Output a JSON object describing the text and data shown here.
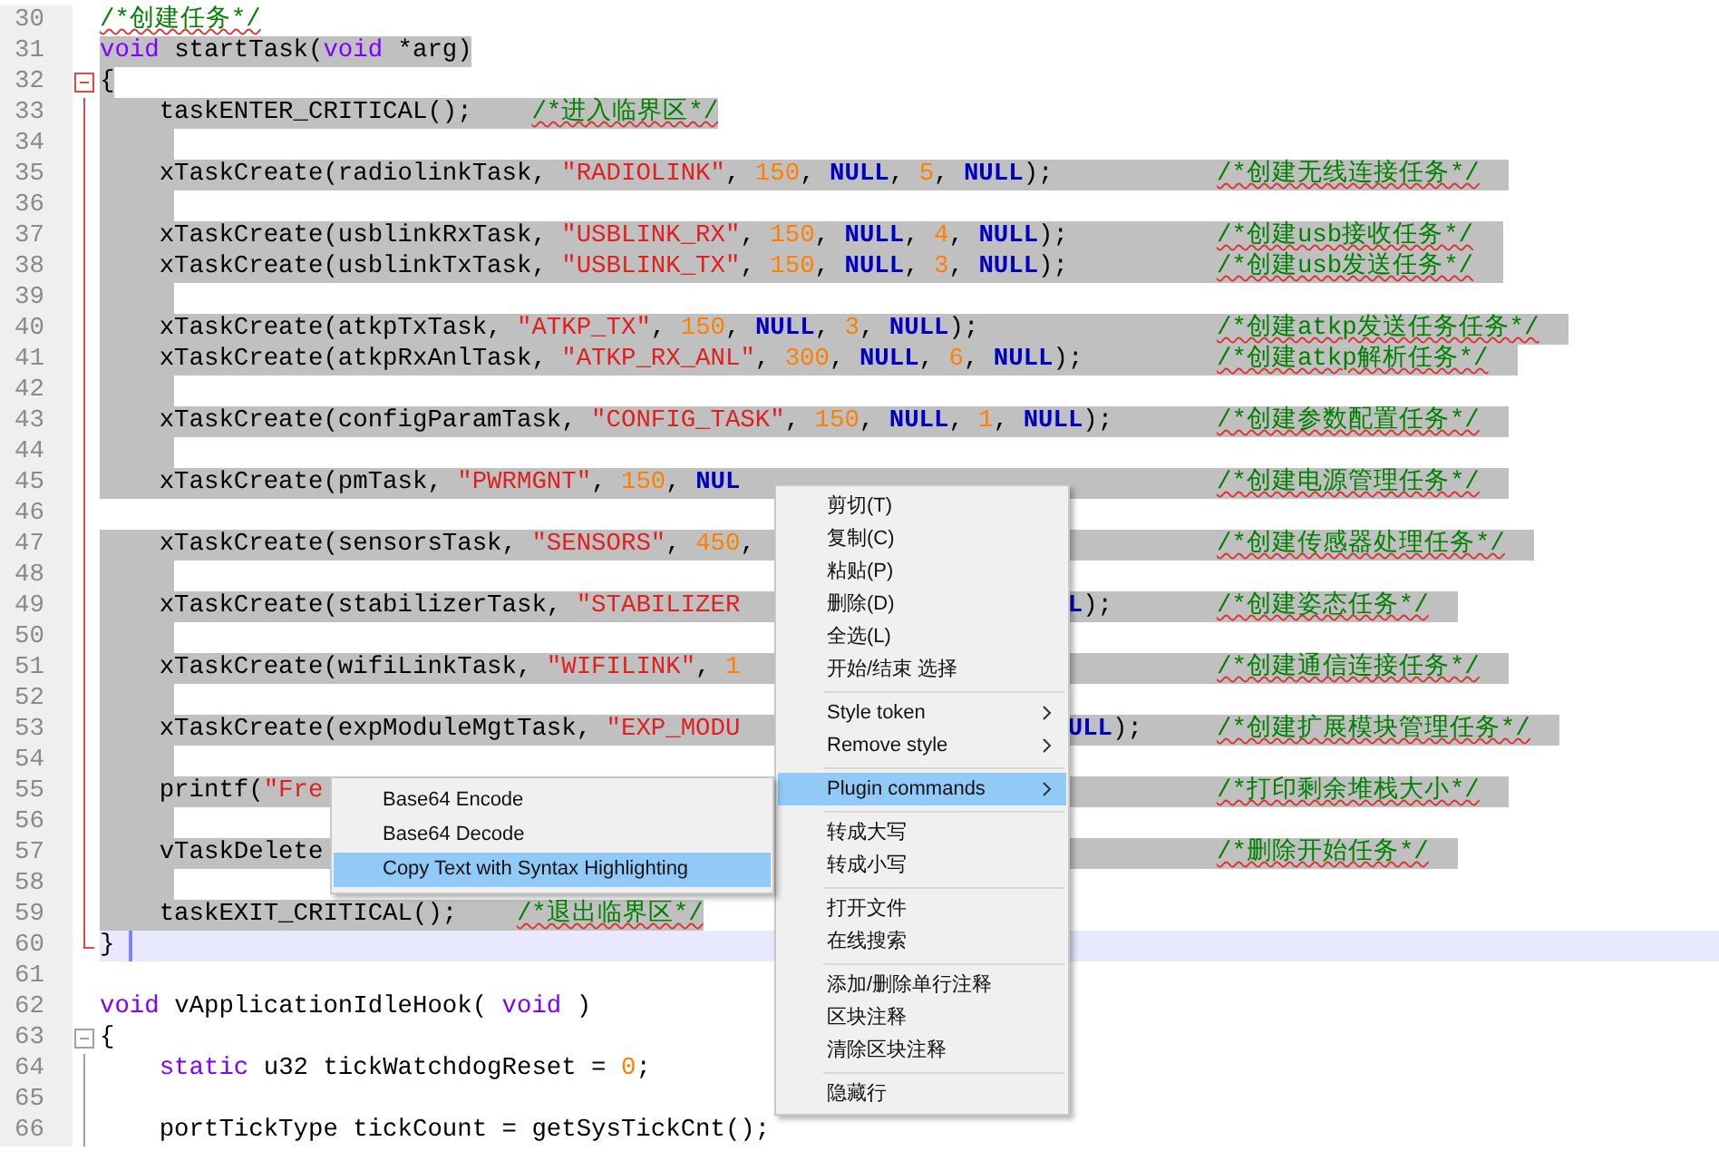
{
  "editor": {
    "lines": [
      {
        "number": "30",
        "selected": false,
        "current": false,
        "indented": false,
        "tokens": [
          {
            "kind": "comment",
            "text": "/*创建任务*/"
          }
        ]
      },
      {
        "number": "31",
        "selected": true,
        "current": false,
        "indented": false,
        "tokens": [
          {
            "kind": "kw",
            "text": "void"
          },
          {
            "kind": "plain",
            "text": " startTask("
          },
          {
            "kind": "kw",
            "text": "void"
          },
          {
            "kind": "plain",
            "text": " *arg)"
          }
        ]
      },
      {
        "number": "32",
        "selected": true,
        "current": false,
        "indented": false,
        "fold": {
          "kind": "start",
          "active": true
        },
        "tokens": [
          {
            "kind": "plain",
            "text": "{"
          }
        ]
      },
      {
        "number": "33",
        "selected": true,
        "current": false,
        "indented": true,
        "fold": {
          "kind": "line",
          "active": true
        },
        "tokens": [
          {
            "kind": "plain",
            "text": "taskENTER_CRITICAL();"
          },
          {
            "kind": "comment",
            "text": "/*进入临界区*/"
          }
        ]
      },
      {
        "number": "34",
        "selected": true,
        "current": false,
        "indented": true,
        "fold": {
          "kind": "line",
          "active": true
        }
      },
      {
        "number": "35",
        "selected": true,
        "current": false,
        "indented": true,
        "fold": {
          "kind": "line",
          "active": true
        },
        "tokens": [
          {
            "kind": "plain",
            "text": "xTaskCreate(radiolinkTask, "
          },
          {
            "kind": "str",
            "text": "\"RADIOLINK\""
          },
          {
            "kind": "plain",
            "text": ", "
          },
          {
            "kind": "num",
            "text": "150"
          },
          {
            "kind": "plain",
            "text": ", "
          },
          {
            "kind": "null",
            "text": "NULL"
          },
          {
            "kind": "plain",
            "text": ", "
          },
          {
            "kind": "num",
            "text": "5"
          },
          {
            "kind": "plain",
            "text": ", "
          },
          {
            "kind": "null",
            "text": "NULL"
          },
          {
            "kind": "plain",
            "text": ");"
          }
        ],
        "comment": "/*创建无线连接任务*/"
      },
      {
        "number": "36",
        "selected": true,
        "current": false,
        "indented": true,
        "fold": {
          "kind": "line",
          "active": true
        }
      },
      {
        "number": "37",
        "selected": true,
        "current": false,
        "indented": true,
        "fold": {
          "kind": "line",
          "active": true
        },
        "tokens": [
          {
            "kind": "plain",
            "text": "xTaskCreate(usblinkRxTask, "
          },
          {
            "kind": "str",
            "text": "\"USBLINK_RX\""
          },
          {
            "kind": "plain",
            "text": ", "
          },
          {
            "kind": "num",
            "text": "150"
          },
          {
            "kind": "plain",
            "text": ", "
          },
          {
            "kind": "null",
            "text": "NULL"
          },
          {
            "kind": "plain",
            "text": ", "
          },
          {
            "kind": "num",
            "text": "4"
          },
          {
            "kind": "plain",
            "text": ", "
          },
          {
            "kind": "null",
            "text": "NULL"
          },
          {
            "kind": "plain",
            "text": ");"
          }
        ],
        "comment": "/*创建usb接收任务*/"
      },
      {
        "number": "38",
        "selected": true,
        "current": false,
        "indented": true,
        "fold": {
          "kind": "line",
          "active": true
        },
        "tokens": [
          {
            "kind": "plain",
            "text": "xTaskCreate(usblinkTxTask, "
          },
          {
            "kind": "str",
            "text": "\"USBLINK_TX\""
          },
          {
            "kind": "plain",
            "text": ", "
          },
          {
            "kind": "num",
            "text": "150"
          },
          {
            "kind": "plain",
            "text": ", "
          },
          {
            "kind": "null",
            "text": "NULL"
          },
          {
            "kind": "plain",
            "text": ", "
          },
          {
            "kind": "num",
            "text": "3"
          },
          {
            "kind": "plain",
            "text": ", "
          },
          {
            "kind": "null",
            "text": "NULL"
          },
          {
            "kind": "plain",
            "text": ");"
          }
        ],
        "comment": "/*创建usb发送任务*/"
      },
      {
        "number": "39",
        "selected": true,
        "current": false,
        "indented": true,
        "fold": {
          "kind": "line",
          "active": true
        }
      },
      {
        "number": "40",
        "selected": true,
        "current": false,
        "indented": true,
        "fold": {
          "kind": "line",
          "active": true
        },
        "tokens": [
          {
            "kind": "plain",
            "text": "xTaskCreate(atkpTxTask, "
          },
          {
            "kind": "str",
            "text": "\"ATKP_TX\""
          },
          {
            "kind": "plain",
            "text": ", "
          },
          {
            "kind": "num",
            "text": "150"
          },
          {
            "kind": "plain",
            "text": ", "
          },
          {
            "kind": "null",
            "text": "NULL"
          },
          {
            "kind": "plain",
            "text": ", "
          },
          {
            "kind": "num",
            "text": "3"
          },
          {
            "kind": "plain",
            "text": ", "
          },
          {
            "kind": "null",
            "text": "NULL"
          },
          {
            "kind": "plain",
            "text": ");"
          }
        ],
        "comment": "/*创建atkp发送任务任务*/"
      },
      {
        "number": "41",
        "selected": true,
        "current": false,
        "indented": true,
        "fold": {
          "kind": "line",
          "active": true
        },
        "tokens": [
          {
            "kind": "plain",
            "text": "xTaskCreate(atkpRxAnlTask, "
          },
          {
            "kind": "str",
            "text": "\"ATKP_RX_ANL\""
          },
          {
            "kind": "plain",
            "text": ", "
          },
          {
            "kind": "num",
            "text": "300"
          },
          {
            "kind": "plain",
            "text": ", "
          },
          {
            "kind": "null",
            "text": "NULL"
          },
          {
            "kind": "plain",
            "text": ", "
          },
          {
            "kind": "num",
            "text": "6"
          },
          {
            "kind": "plain",
            "text": ", "
          },
          {
            "kind": "null",
            "text": "NULL"
          },
          {
            "kind": "plain",
            "text": ");"
          }
        ],
        "comment": "/*创建atkp解析任务*/"
      },
      {
        "number": "42",
        "selected": true,
        "current": false,
        "indented": true,
        "fold": {
          "kind": "line",
          "active": true
        }
      },
      {
        "number": "43",
        "selected": true,
        "current": false,
        "indented": true,
        "fold": {
          "kind": "line",
          "active": true
        },
        "tokens": [
          {
            "kind": "plain",
            "text": "xTaskCreate(configParamTask, "
          },
          {
            "kind": "str",
            "text": "\"CONFIG_TASK\""
          },
          {
            "kind": "plain",
            "text": ", "
          },
          {
            "kind": "num",
            "text": "150"
          },
          {
            "kind": "plain",
            "text": ", "
          },
          {
            "kind": "null",
            "text": "NULL"
          },
          {
            "kind": "plain",
            "text": ", "
          },
          {
            "kind": "num",
            "text": "1"
          },
          {
            "kind": "plain",
            "text": ", "
          },
          {
            "kind": "null",
            "text": "NULL"
          },
          {
            "kind": "plain",
            "text": ");"
          }
        ],
        "comment": "/*创建参数配置任务*/"
      },
      {
        "number": "44",
        "selected": true,
        "current": false,
        "indented": true,
        "fold": {
          "kind": "line",
          "active": true
        }
      },
      {
        "number": "45",
        "selected": true,
        "current": false,
        "indented": true,
        "fold": {
          "kind": "line",
          "active": true
        },
        "tokens": [
          {
            "kind": "plain",
            "text": "xTaskCreate(pmTask, "
          },
          {
            "kind": "str",
            "text": "\"PWRMGNT\""
          },
          {
            "kind": "plain",
            "text": ", "
          },
          {
            "kind": "num",
            "text": "150"
          },
          {
            "kind": "plain",
            "text": ", "
          },
          {
            "kind": "null",
            "text": "NUL"
          }
        ],
        "comment": "/*创建电源管理任务*/"
      },
      {
        "number": "46",
        "selected": false,
        "current": false,
        "fold": {
          "kind": "line",
          "active": true
        }
      },
      {
        "number": "47",
        "selected": true,
        "current": false,
        "indented": true,
        "fold": {
          "kind": "line",
          "active": true
        },
        "tokens": [
          {
            "kind": "plain",
            "text": "xTaskCreate(sensorsTask, "
          },
          {
            "kind": "str",
            "text": "\"SENSORS\""
          },
          {
            "kind": "plain",
            "text": ", "
          },
          {
            "kind": "num",
            "text": "450"
          },
          {
            "kind": "plain",
            "text": ","
          }
        ],
        "comment": "/*创建传感器处理任务*/"
      },
      {
        "number": "48",
        "selected": true,
        "current": false,
        "indented": true,
        "fold": {
          "kind": "line",
          "active": true
        }
      },
      {
        "number": "49",
        "selected": true,
        "current": false,
        "indented": true,
        "fold": {
          "kind": "line",
          "active": true
        },
        "tokens": [
          {
            "kind": "plain",
            "text": "xTaskCreate(stabilizerTask, "
          },
          {
            "kind": "str",
            "text": "\"STABILIZER"
          }
        ],
        "tail": [
          {
            "kind": "null",
            "text": "L"
          },
          {
            "kind": "plain",
            "text": ");"
          }
        ],
        "comment": "/*创建姿态任务*/"
      },
      {
        "number": "50",
        "selected": true,
        "current": false,
        "indented": true,
        "fold": {
          "kind": "line",
          "active": true
        }
      },
      {
        "number": "51",
        "selected": true,
        "current": false,
        "indented": true,
        "fold": {
          "kind": "line",
          "active": true
        },
        "tokens": [
          {
            "kind": "plain",
            "text": "xTaskCreate(wifiLinkTask, "
          },
          {
            "kind": "str",
            "text": "\"WIFILINK\""
          },
          {
            "kind": "plain",
            "text": ", "
          },
          {
            "kind": "num",
            "text": "1"
          }
        ],
        "comment": "/*创建通信连接任务*/"
      },
      {
        "number": "52",
        "selected": true,
        "current": false,
        "indented": true,
        "fold": {
          "kind": "line",
          "active": true
        }
      },
      {
        "number": "53",
        "selected": true,
        "current": false,
        "indented": true,
        "fold": {
          "kind": "line",
          "active": true
        },
        "tokens": [
          {
            "kind": "plain",
            "text": "xTaskCreate(expModuleMgtTask, "
          },
          {
            "kind": "str",
            "text": "\"EXP_MODU"
          }
        ],
        "tail": [
          {
            "kind": "null",
            "text": "ULL"
          },
          {
            "kind": "plain",
            "text": ");"
          }
        ],
        "comment": "/*创建扩展模块管理任务*/"
      },
      {
        "number": "54",
        "selected": true,
        "current": false,
        "indented": true,
        "fold": {
          "kind": "line",
          "active": true
        }
      },
      {
        "number": "55",
        "selected": true,
        "current": false,
        "indented": true,
        "fold": {
          "kind": "line",
          "active": true
        },
        "tokens": [
          {
            "kind": "plain",
            "text": "printf("
          },
          {
            "kind": "str",
            "text": "\"Fre"
          }
        ],
        "comment": "/*打印剩余堆栈大小*/"
      },
      {
        "number": "56",
        "selected": true,
        "current": false,
        "indented": true,
        "fold": {
          "kind": "line",
          "active": true
        }
      },
      {
        "number": "57",
        "selected": true,
        "current": false,
        "indented": true,
        "fold": {
          "kind": "line",
          "active": true
        },
        "tokens": [
          {
            "kind": "plain",
            "text": "vTaskDelete"
          }
        ],
        "comment": "/*删除开始任务*/"
      },
      {
        "number": "58",
        "selected": true,
        "current": false,
        "indented": true,
        "fold": {
          "kind": "line",
          "active": true
        }
      },
      {
        "number": "59",
        "selected": true,
        "current": false,
        "indented": true,
        "fold": {
          "kind": "line",
          "active": true
        },
        "tokens": [
          {
            "kind": "plain",
            "text": "taskEXIT_CRITICAL();"
          },
          {
            "kind": "comment",
            "text": "/*退出临界区*/"
          }
        ]
      },
      {
        "number": "60",
        "selected": false,
        "current": true,
        "indented": false,
        "fold": {
          "kind": "end",
          "active": true
        },
        "tokens": [
          {
            "kind": "plain",
            "text": "}"
          }
        ]
      },
      {
        "number": "61",
        "selected": false,
        "current": false
      },
      {
        "number": "62",
        "selected": false,
        "current": false,
        "indented": false,
        "tokens": [
          {
            "kind": "kw",
            "text": "void"
          },
          {
            "kind": "plain",
            "text": " vApplicationIdleHook( "
          },
          {
            "kind": "kw",
            "text": "void"
          },
          {
            "kind": "plain",
            "text": " )"
          }
        ]
      },
      {
        "number": "63",
        "selected": false,
        "current": false,
        "indented": false,
        "fold": {
          "kind": "start",
          "active": false
        },
        "tokens": [
          {
            "kind": "plain",
            "text": "{"
          }
        ]
      },
      {
        "number": "64",
        "selected": false,
        "current": false,
        "indented": true,
        "fold": {
          "kind": "line",
          "active": false
        },
        "tokens": [
          {
            "kind": "kw",
            "text": "static"
          },
          {
            "kind": "plain",
            "text": " u32 tickWatchdogReset = "
          },
          {
            "kind": "num",
            "text": "0"
          },
          {
            "kind": "plain",
            "text": ";"
          }
        ]
      },
      {
        "number": "65",
        "selected": false,
        "current": false,
        "fold": {
          "kind": "line",
          "active": false
        }
      },
      {
        "number": "66",
        "selected": false,
        "current": false,
        "indented": true,
        "fold": {
          "kind": "line",
          "active": false
        },
        "tokens": [
          {
            "kind": "plain",
            "text": "portTickType tickCount = getSysTickCnt();"
          }
        ]
      }
    ]
  },
  "context_menu": {
    "groups": [
      [
        {
          "label": "剪切(T)",
          "selected": false,
          "submenu": false
        },
        {
          "label": "复制(C)",
          "selected": false,
          "submenu": false
        },
        {
          "label": "粘贴(P)",
          "selected": false,
          "submenu": false
        },
        {
          "label": "删除(D)",
          "selected": false,
          "submenu": false
        },
        {
          "label": "全选(L)",
          "selected": false,
          "submenu": false
        },
        {
          "label": "开始/结束 选择",
          "selected": false,
          "submenu": false
        }
      ],
      [
        {
          "label": "Style token",
          "selected": false,
          "submenu": true
        },
        {
          "label": "Remove style",
          "selected": false,
          "submenu": true
        }
      ],
      [
        {
          "label": "Plugin commands",
          "selected": true,
          "submenu": true
        }
      ],
      [
        {
          "label": "转成大写",
          "selected": false,
          "submenu": false
        },
        {
          "label": "转成小写",
          "selected": false,
          "submenu": false
        }
      ],
      [
        {
          "label": "打开文件",
          "selected": false,
          "submenu": false
        },
        {
          "label": "在线搜索",
          "selected": false,
          "submenu": false
        }
      ],
      [
        {
          "label": "添加/删除单行注释",
          "selected": false,
          "submenu": false
        },
        {
          "label": "区块注释",
          "selected": false,
          "submenu": false
        },
        {
          "label": "清除区块注释",
          "selected": false,
          "submenu": false
        }
      ],
      [
        {
          "label": "隐藏行",
          "selected": false,
          "submenu": false
        }
      ]
    ]
  },
  "submenu": {
    "items": [
      {
        "label": "Base64 Encode",
        "selected": false
      },
      {
        "label": "Base64 Decode",
        "selected": false
      },
      {
        "label": "Copy Text with Syntax Highlighting",
        "selected": true
      }
    ]
  }
}
